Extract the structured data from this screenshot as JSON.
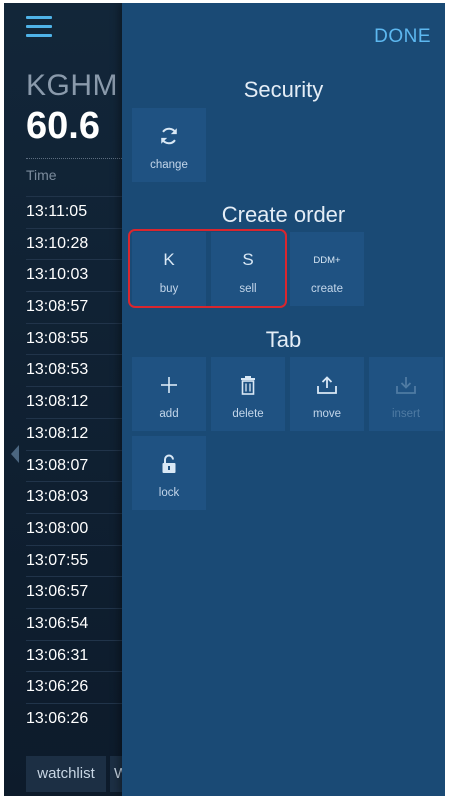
{
  "header": {
    "done_label": "DONE"
  },
  "stock": {
    "ticker": "KGHM",
    "price": "60.6"
  },
  "times": {
    "header": "Time",
    "rows": [
      "13:11:05",
      "13:10:28",
      "13:10:03",
      "13:08:57",
      "13:08:55",
      "13:08:53",
      "13:08:12",
      "13:08:12",
      "13:08:07",
      "13:08:03",
      "13:08:00",
      "13:07:55",
      "13:06:57",
      "13:06:54",
      "13:06:31",
      "13:06:26",
      "13:06:26"
    ]
  },
  "bottom_tabs": {
    "watchlist": "watchlist",
    "second": "W"
  },
  "security": {
    "title": "Security",
    "change": {
      "label": "change",
      "icon": "refresh-icon"
    }
  },
  "create_order": {
    "title": "Create order",
    "buy": {
      "symbol": "K",
      "label": "buy"
    },
    "sell": {
      "symbol": "S",
      "label": "sell"
    },
    "create": {
      "symbol": "DDM+",
      "label": "create"
    }
  },
  "tab": {
    "title": "Tab",
    "add": {
      "label": "add",
      "icon": "plus-icon"
    },
    "delete": {
      "label": "delete",
      "icon": "trash-icon"
    },
    "move": {
      "label": "move",
      "icon": "upload-icon"
    },
    "insert": {
      "label": "insert",
      "icon": "download-icon"
    },
    "lock": {
      "label": "lock",
      "icon": "lock-icon"
    }
  },
  "colors": {
    "panel": "#1a4a75",
    "tile": "#1f5282",
    "accent": "#5db8f0",
    "highlight": "#d9262e"
  }
}
